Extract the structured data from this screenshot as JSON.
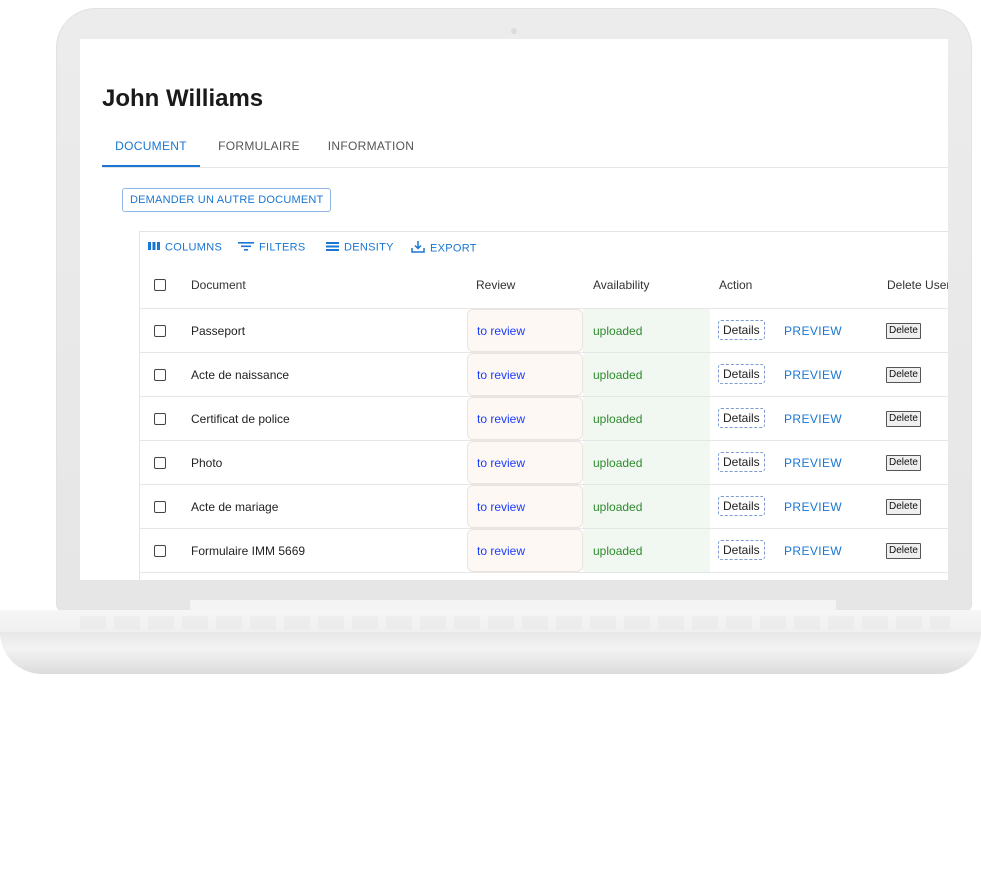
{
  "page": {
    "title": "John Williams"
  },
  "tabs": [
    {
      "label": "DOCUMENT",
      "active": true
    },
    {
      "label": "FORMULAIRE",
      "active": false
    },
    {
      "label": "INFORMATION",
      "active": false
    }
  ],
  "request_button": "DEMANDER UN AUTRE DOCUMENT",
  "toolbar": {
    "columns": "COLUMNS",
    "filters": "FILTERS",
    "density": "DENSITY",
    "export": "EXPORT"
  },
  "table": {
    "headers": {
      "document": "Document",
      "review": "Review",
      "availability": "Availability",
      "action": "Action",
      "delete_user": "Delete User"
    },
    "rows": [
      {
        "document": "Passeport",
        "review": "to review",
        "availability": "uploaded",
        "details": "Details",
        "preview": "PREVIEW",
        "delete": "Delete"
      },
      {
        "document": "Acte de naissance",
        "review": "to review",
        "availability": "uploaded",
        "details": "Details",
        "preview": "PREVIEW",
        "delete": "Delete"
      },
      {
        "document": "Certificat de police",
        "review": "to review",
        "availability": "uploaded",
        "details": "Details",
        "preview": "PREVIEW",
        "delete": "Delete"
      },
      {
        "document": "Photo",
        "review": "to review",
        "availability": "uploaded",
        "details": "Details",
        "preview": "PREVIEW",
        "delete": "Delete"
      },
      {
        "document": "Acte de mariage",
        "review": "to review",
        "availability": "uploaded",
        "details": "Details",
        "preview": "PREVIEW",
        "delete": "Delete"
      },
      {
        "document": "Formulaire IMM 5669",
        "review": "to review",
        "availability": "uploaded",
        "details": "Details",
        "preview": "PREVIEW",
        "delete": "Delete"
      }
    ]
  },
  "colors": {
    "accent": "#1976d2",
    "review_text": "#1a3cff",
    "uploaded_text": "#2e8b2e"
  },
  "icons": {
    "columns": "columns-icon",
    "filters": "filter-icon",
    "density": "density-icon",
    "export": "export-icon"
  }
}
